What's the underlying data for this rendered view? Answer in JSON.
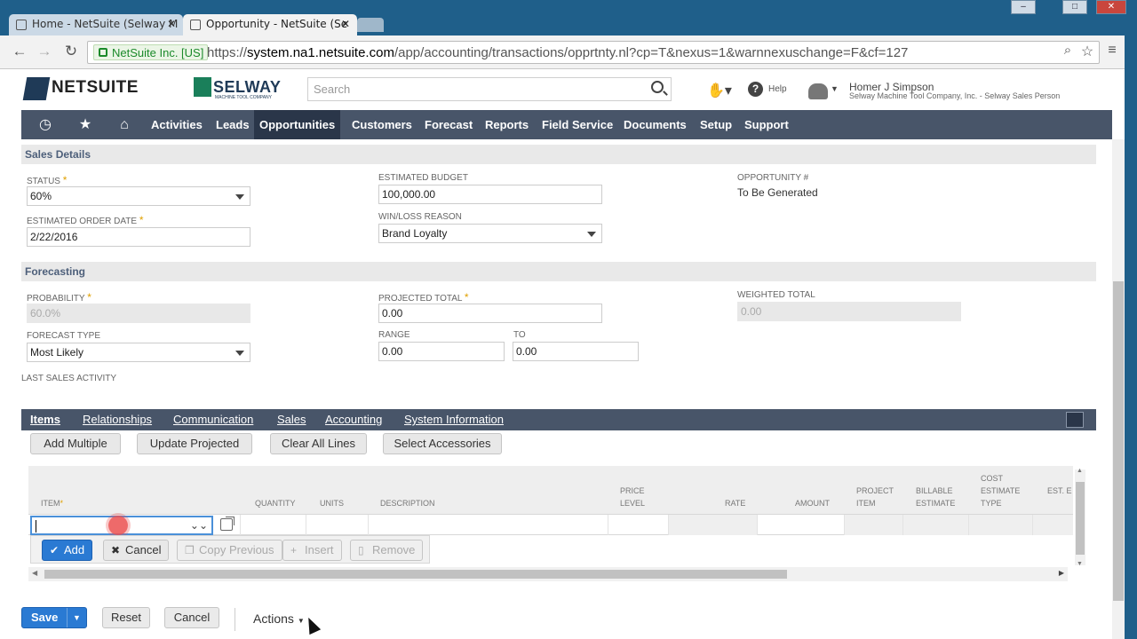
{
  "browser": {
    "tabs": [
      {
        "title": "Home - NetSuite (Selway M"
      },
      {
        "title": "Opportunity - NetSuite (Se"
      }
    ],
    "close_glyph": "✕",
    "window_buttons": [
      "–",
      "□",
      "✕"
    ],
    "ssl_label": "NetSuite Inc. [US]",
    "url_prefix": "https://",
    "url_host": "system.na1.netsuite.com",
    "url_path": "/app/accounting/transactions/opprtnty.nl?cp=T&nexus=1&warnnexuschange=F&cf=127",
    "icons": [
      "back-icon",
      "forward-icon",
      "reload-icon",
      "zoom-icon",
      "star-icon",
      "menu-icon"
    ]
  },
  "header": {
    "brand": "NETSUITE",
    "company_logo": "SELWAY",
    "company_logo_sub": "MACHINE TOOL COMPANY",
    "search_placeholder": "Search",
    "help_label": "Help",
    "user_name": "Homer J Simpson",
    "user_role": "Selway Machine Tool Company, Inc. - Selway Sales Person"
  },
  "nav": {
    "items": [
      "Activities",
      "Leads",
      "Opportunities",
      "Customers",
      "Forecast",
      "Reports",
      "Field Service",
      "Documents",
      "Setup",
      "Support"
    ],
    "active": "Opportunities"
  },
  "sales_details": {
    "title": "Sales Details",
    "status_label": "STATUS",
    "status_value": "60%",
    "order_date_label": "ESTIMATED ORDER DATE",
    "order_date_value": "2/22/2016",
    "budget_label": "ESTIMATED BUDGET",
    "budget_value": "100,000.00",
    "winloss_label": "WIN/LOSS REASON",
    "winloss_value": "Brand Loyalty",
    "opp_label": "OPPORTUNITY #",
    "opp_value": "To Be Generated"
  },
  "forecasting": {
    "title": "Forecasting",
    "probability_label": "PROBABILITY",
    "probability_value": "60.0%",
    "projected_label": "PROJECTED TOTAL",
    "projected_value": "0.00",
    "weighted_label": "WEIGHTED TOTAL",
    "weighted_value": "0.00",
    "forecast_type_label": "FORECAST TYPE",
    "forecast_type_value": "Most Likely",
    "range_label": "RANGE",
    "range_from": "0.00",
    "to_label": "TO",
    "range_to": "0.00",
    "last_activity_label": "LAST SALES ACTIVITY"
  },
  "subtabs": {
    "items": [
      "Items",
      "Relationships",
      "Communication",
      "Sales",
      "Accounting",
      "System Information"
    ],
    "active": "Items"
  },
  "machine_buttons": [
    "Add Multiple",
    "Update Projected",
    "Clear All Lines",
    "Select Accessories"
  ],
  "grid": {
    "columns": [
      "ITEM",
      "QUANTITY",
      "UNITS",
      "DESCRIPTION",
      "PRICE LEVEL",
      "RATE",
      "AMOUNT",
      "PROJECT ITEM",
      "BILLABLE ESTIMATE",
      "COST ESTIMATE TYPE",
      "EST. E"
    ],
    "required_marker": "*",
    "line_buttons": {
      "add": "Add",
      "cancel": "Cancel",
      "copy_previous": "Copy Previous",
      "insert": "Insert",
      "remove": "Remove"
    }
  },
  "footer": {
    "save": "Save",
    "reset": "Reset",
    "cancel": "Cancel",
    "actions": "Actions"
  },
  "colors": {
    "nav_bg": "#485569",
    "nav_active": "#2a3649",
    "primary_button": "#2a7ad3",
    "required_star": "#e0a000",
    "browser_frame": "#1f5f8a"
  }
}
